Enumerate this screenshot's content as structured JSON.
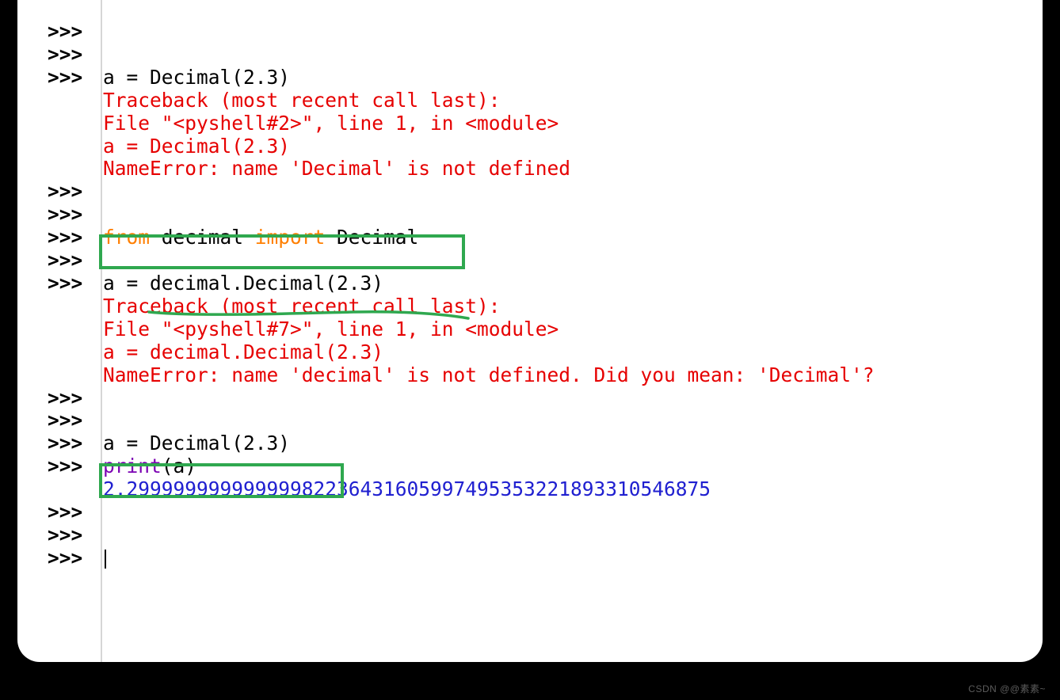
{
  "prompts": {
    "primary": ">>>"
  },
  "lines": [
    {
      "p": ">>>",
      "cls": "txt",
      "text": ""
    },
    {
      "p": ">>>",
      "cls": "txt",
      "text": ""
    },
    {
      "p": ">>>",
      "cls": "txt",
      "text": "a = Decimal(2.3)"
    },
    {
      "p": "",
      "cls": "err",
      "text": "Traceback (most recent call last):"
    },
    {
      "p": "",
      "cls": "err",
      "text": "  File \"<pyshell#2>\", line 1, in <module>"
    },
    {
      "p": "",
      "cls": "err",
      "text": "    a = Decimal(2.3)"
    },
    {
      "p": "",
      "cls": "err",
      "text": "NameError: name 'Decimal' is not defined"
    },
    {
      "p": ">>>",
      "cls": "txt",
      "text": ""
    },
    {
      "p": ">>>",
      "cls": "txt",
      "text": ""
    },
    {
      "p": ">>>",
      "cls": "import",
      "text": ""
    },
    {
      "p": ">>>",
      "cls": "txt",
      "text": ""
    },
    {
      "p": ">>>",
      "cls": "txt",
      "text": "a = decimal.Decimal(2.3)"
    },
    {
      "p": "",
      "cls": "err",
      "text": "Traceback (most recent call last):"
    },
    {
      "p": "",
      "cls": "err",
      "text": "  File \"<pyshell#7>\", line 1, in <module>"
    },
    {
      "p": "",
      "cls": "err",
      "text": "    a = decimal.Decimal(2.3)"
    },
    {
      "p": "",
      "cls": "err",
      "text": "NameError: name 'decimal' is not defined. Did you mean: 'Decimal'?"
    },
    {
      "p": ">>>",
      "cls": "txt",
      "text": ""
    },
    {
      "p": ">>>",
      "cls": "txt",
      "text": ""
    },
    {
      "p": ">>>",
      "cls": "txt",
      "text": "a = Decimal(2.3)"
    },
    {
      "p": ">>>",
      "cls": "print",
      "text": ""
    },
    {
      "p": "",
      "cls": "out",
      "text": "2.29999999999999982236431605997495353221893310546875"
    },
    {
      "p": ">>>",
      "cls": "txt",
      "text": ""
    },
    {
      "p": ">>>",
      "cls": "txt",
      "text": ""
    },
    {
      "p": ">>>",
      "cls": "caret",
      "text": ""
    }
  ],
  "import_line": {
    "kw_from": "from",
    "module": " decimal ",
    "kw_import": "import",
    "name": " Decimal"
  },
  "print_line": {
    "fn": "print",
    "arg": "(a)"
  },
  "watermark": "CSDN @@素素~"
}
